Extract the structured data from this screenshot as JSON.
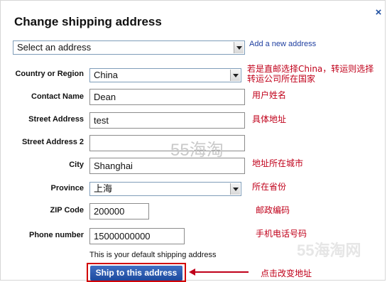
{
  "dialog": {
    "title": "Change shipping address",
    "close_label": "×"
  },
  "address_select": {
    "selected": "Select an address",
    "add_new_link": "Add a new address"
  },
  "form": {
    "country": {
      "label": "Country or Region",
      "value": "China"
    },
    "contact": {
      "label": "Contact Name",
      "value": "Dean"
    },
    "street": {
      "label": "Street Address",
      "value": "test"
    },
    "street2": {
      "label": "Street Address 2",
      "value": ""
    },
    "city": {
      "label": "City",
      "value": "Shanghai"
    },
    "province": {
      "label": "Province",
      "value": "上海"
    },
    "zip": {
      "label": "ZIP Code",
      "value": "200000"
    },
    "phone": {
      "label": "Phone number",
      "value": "15000000000"
    }
  },
  "annotations": {
    "country_line1": "若是直邮选择China，转运则选择",
    "country_line2": "转运公司所在国家",
    "contact": "用户姓名",
    "street": "具体地址",
    "city": "地址所在城市",
    "province": "所在省份",
    "zip": "邮政编码",
    "phone": "手机电话号码",
    "ship_button": "点击改变地址"
  },
  "default_notice": "This is your default shipping address",
  "ship_button_label": "Ship to this address",
  "watermarks": {
    "center": "55海淘",
    "corner": "55海淘网"
  },
  "colors": {
    "annotation_red": "#c0001a",
    "link_blue": "#1f3fa0",
    "button_blue": "#1d4a9d"
  }
}
